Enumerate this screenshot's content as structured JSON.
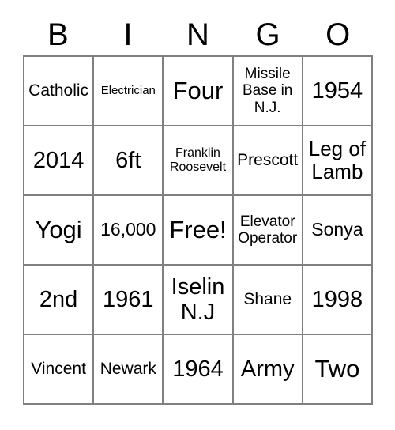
{
  "card": {
    "title_letters": [
      "B",
      "I",
      "N",
      "G",
      "O"
    ],
    "columns": 5,
    "rows": 5,
    "free_space_label": "Free!",
    "colors": {
      "background": "#ffffff",
      "text": "#000000",
      "grid_line": "#808080"
    },
    "cells": [
      [
        {
          "text": "Catholic",
          "size": "ml"
        },
        {
          "text": "Electrician",
          "size": "xs"
        },
        {
          "text": "Four",
          "size": "max"
        },
        {
          "text": "Missile\nBase in\nN.J.",
          "size": "m"
        },
        {
          "text": "1954",
          "size": "xxl"
        }
      ],
      [
        {
          "text": "2014",
          "size": "xxl"
        },
        {
          "text": "6ft",
          "size": "xxl"
        },
        {
          "text": "Franklin\nRoosevelt",
          "size": "s"
        },
        {
          "text": "Prescott",
          "size": "ml"
        },
        {
          "text": "Leg of\nLamb",
          "size": "xl"
        }
      ],
      [
        {
          "text": "Yogi",
          "size": "max"
        },
        {
          "text": "16,000",
          "size": "l"
        },
        {
          "text": "Free!",
          "size": "max"
        },
        {
          "text": "Elevator\nOperator",
          "size": "m"
        },
        {
          "text": "Sonya",
          "size": "l"
        }
      ],
      [
        {
          "text": "2nd",
          "size": "xxl"
        },
        {
          "text": "1961",
          "size": "xxl"
        },
        {
          "text": "Iselin\nN.J",
          "size": "xxl"
        },
        {
          "text": "Shane",
          "size": "ml"
        },
        {
          "text": "1998",
          "size": "xxl"
        }
      ],
      [
        {
          "text": "Vincent",
          "size": "ml"
        },
        {
          "text": "Newark",
          "size": "ml"
        },
        {
          "text": "1964",
          "size": "xxl"
        },
        {
          "text": "Army",
          "size": "xxl"
        },
        {
          "text": "Two",
          "size": "max"
        }
      ]
    ]
  }
}
